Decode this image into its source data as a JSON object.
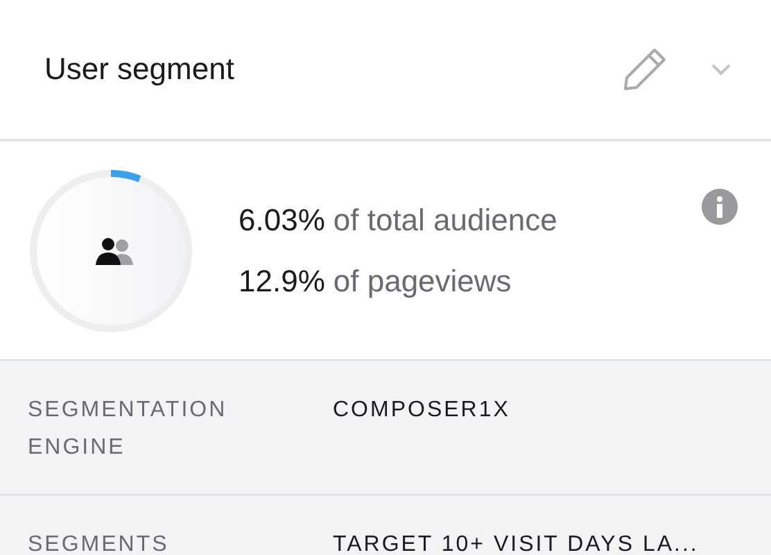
{
  "header": {
    "title": "User segment"
  },
  "stats": {
    "level": 0.0603,
    "lines": [
      {
        "value": "6.03%",
        "label": "of total audience"
      },
      {
        "value": "12.9%",
        "label": "of pageviews"
      }
    ]
  },
  "details": [
    {
      "label": "SEGMENTATION ENGINE",
      "value": "COMPOSER1X"
    },
    {
      "label": "SEGMENTS",
      "value": "TARGET 10+ VISIT DAYS LA..."
    }
  ]
}
